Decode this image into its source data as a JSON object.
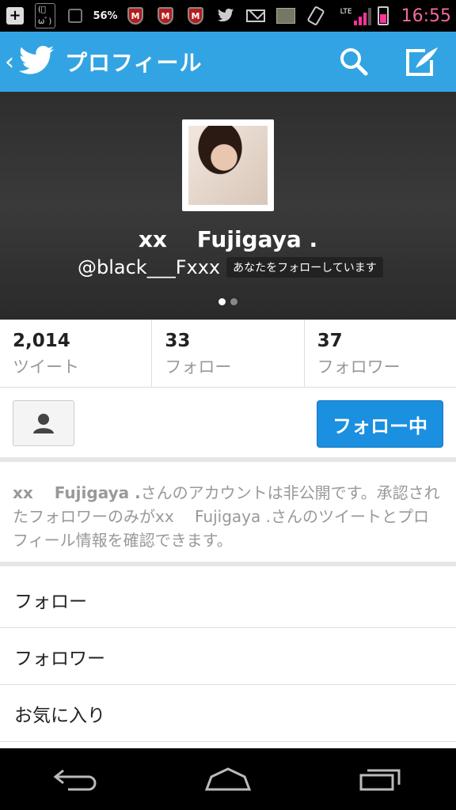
{
  "status_bar": {
    "time": "16:55",
    "battery_percent_label": "56%",
    "network": "LTE",
    "icons": [
      "add-icon",
      "emoticon-icon",
      "sync-icon",
      "battery-widget-icon",
      "mcafee-icon",
      "mcafee-icon",
      "mcafee-icon",
      "twitter-icon",
      "mail-icon",
      "image-icon",
      "rotate-icon",
      "signal-icon",
      "battery-icon"
    ]
  },
  "action_bar": {
    "title": "プロフィール",
    "brand_color": "#33a4e3"
  },
  "profile": {
    "display_name": "xx　 Fujigaya .",
    "handle": "@black___Fxxx",
    "follows_you_badge": "あなたをフォローしています"
  },
  "stats": [
    {
      "count": "2,014",
      "label": "ツイート"
    },
    {
      "count": "33",
      "label": "フォロー"
    },
    {
      "count": "37",
      "label": "フォロワー"
    }
  ],
  "buttons": {
    "following_label": "フォロー中",
    "following_color": "#1b8fe0"
  },
  "private_notice": {
    "name": "xx　 Fujigaya .",
    "text1": "さんのアカウントは非公開です。承認されたフォロワーのみが",
    "name_inline": "xx　 Fujigaya .",
    "text2": "さんのツイートとプロフィール情報を確認できます。"
  },
  "menu": [
    {
      "label": "フォロー"
    },
    {
      "label": "フォロワー"
    },
    {
      "label": "お気に入り"
    }
  ]
}
